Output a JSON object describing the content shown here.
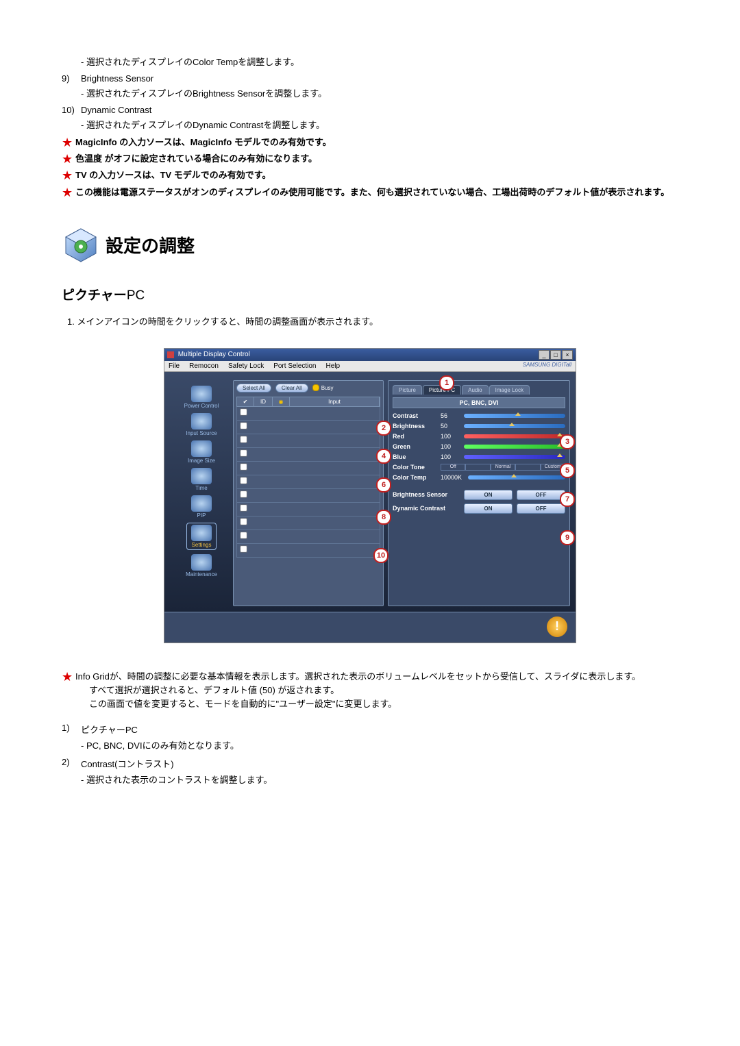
{
  "top_items": [
    {
      "num": "",
      "title": "",
      "desc": "- 選択されたディスプレイのColor Tempを調整します。"
    },
    {
      "num": "9)",
      "title": "Brightness Sensor",
      "desc": "- 選択されたディスプレイのBrightness Sensorを調整します。"
    },
    {
      "num": "10)",
      "title": "Dynamic Contrast",
      "desc": "- 選択されたディスプレイのDynamic Contrastを調整します。"
    }
  ],
  "notes_top": [
    {
      "text": "MagicInfo の入力ソースは、MagicInfo モデルでのみ有効です。",
      "bold": true
    },
    {
      "text": "色温度 がオフに設定されている場合にのみ有効になります。",
      "bold": true
    },
    {
      "text": "TV の入力ソースは、TV モデルでのみ有効です。",
      "bold": true
    },
    {
      "text": "この機能は電源ステータスがオンのディスプレイのみ使用可能です。また、何も選択されていない場合、工場出荷時のデフォルト値が表示されます。",
      "bold": true
    }
  ],
  "section_heading": "設定の調整",
  "sub_heading_prefix": "ピクチャー",
  "sub_heading_suffix": "PC",
  "instruction": "1.  メインアイコンの時間をクリックすると、時間の調整画面が表示されます。",
  "mdc": {
    "title": "Multiple Display Control",
    "menu": [
      "File",
      "Remocon",
      "Safety Lock",
      "Port Selection",
      "Help"
    ],
    "brand": "SAMSUNG DIGITall",
    "sidebar": [
      {
        "label": "Power Control"
      },
      {
        "label": "Input Source"
      },
      {
        "label": "Image Size"
      },
      {
        "label": "Time"
      },
      {
        "label": "PIP"
      },
      {
        "label": "Settings",
        "selected": true
      },
      {
        "label": "Maintenance"
      }
    ],
    "toolbar": {
      "select_all": "Select All",
      "clear_all": "Clear All",
      "busy": "Busy"
    },
    "grid_header": {
      "chk": "✔",
      "id": "ID",
      "icon": "◉",
      "input": "Input"
    },
    "tabs": [
      "Picture",
      "Picture PC",
      "Audio",
      "Image Lock"
    ],
    "active_tab": 1,
    "mode_line": "PC, BNC, DVI",
    "controls": {
      "contrast": {
        "label": "Contrast",
        "value": "56"
      },
      "brightness": {
        "label": "Brightness",
        "value": "50"
      },
      "red": {
        "label": "Red",
        "value": "100"
      },
      "green": {
        "label": "Green",
        "value": "100"
      },
      "blue": {
        "label": "Blue",
        "value": "100"
      },
      "color_tone": {
        "label": "Color Tone",
        "segs": [
          "Off",
          "",
          "Normal",
          "",
          "Custom"
        ]
      },
      "color_temp": {
        "label": "Color Temp",
        "value": "10000K"
      },
      "brightness_sensor": {
        "label": "Brightness Sensor",
        "on": "ON",
        "off": "OFF"
      },
      "dynamic_contrast": {
        "label": "Dynamic Contrast",
        "on": "ON",
        "off": "OFF"
      }
    },
    "callouts": [
      "1",
      "2",
      "3",
      "4",
      "5",
      "6",
      "7",
      "8",
      "9",
      "10"
    ]
  },
  "bottom_note": {
    "main": "Info Gridが、時間の調整に必要な基本情報を表示します。選択された表示のボリュームレベルをセットから受信して、スライダに表示します。",
    "sub1": "すべて選択が選択されると、デフォルト値 (50) が返されます。",
    "sub2": "この画面で値を変更すると、モードを自動的に\"ユーザー設定\"に変更します。"
  },
  "bottom_items": [
    {
      "num": "1)",
      "title": "ピクチャーPC",
      "desc": "- PC, BNC, DVIにのみ有効となります。"
    },
    {
      "num": "2)",
      "title": "Contrast(コントラスト)",
      "desc": "- 選択された表示のコントラストを調整します。"
    }
  ]
}
